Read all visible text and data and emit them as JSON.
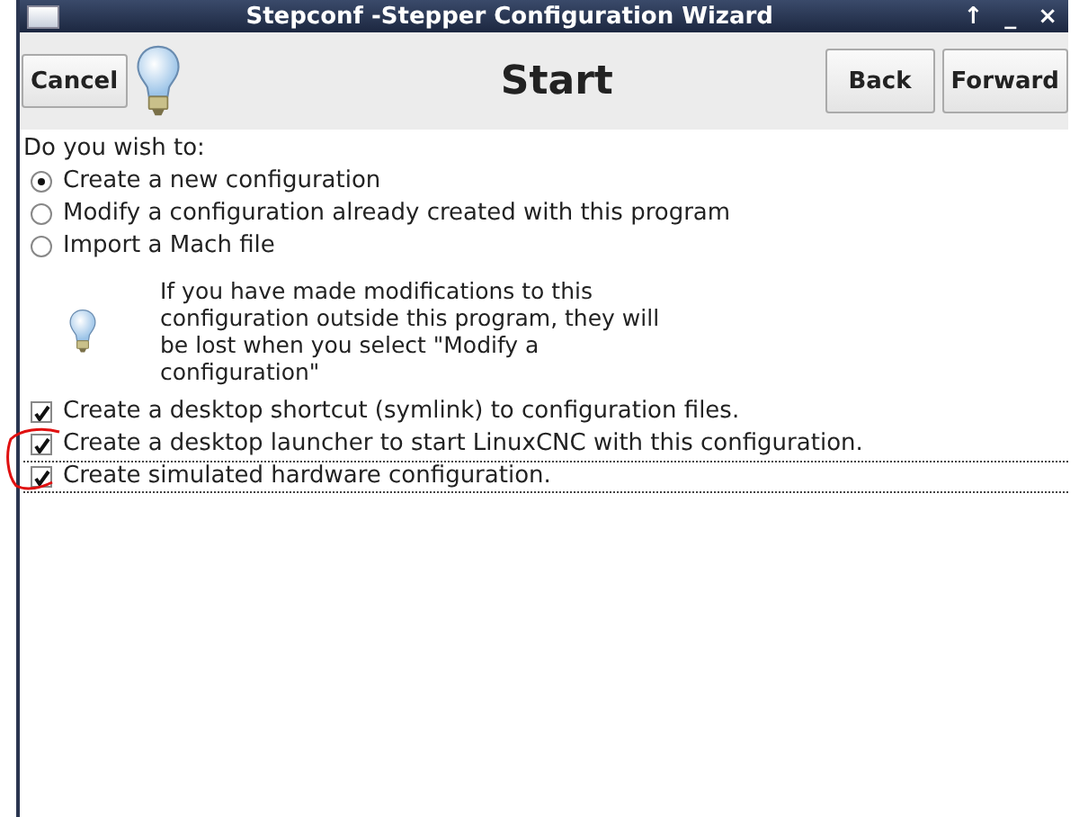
{
  "window": {
    "title": "Stepconf -Stepper Configuration Wizard",
    "controls": [
      "↑",
      "_",
      "×"
    ]
  },
  "toolbar": {
    "cancel": "Cancel",
    "title": "Start",
    "back": "Back",
    "forward": "Forward"
  },
  "prompt": "Do you wish to:",
  "options": [
    {
      "label": "Create a new configuration",
      "selected": true
    },
    {
      "label": "Modify a configuration already created with this program",
      "selected": false
    },
    {
      "label": "Import a Mach file",
      "selected": false
    }
  ],
  "note": "If you have made modifications to this configuration outside this program, they will be lost when you select \"Modify a configuration\"",
  "checks": [
    {
      "label": "Create a desktop shortcut (symlink) to configuration files.",
      "checked": true,
      "focused": false
    },
    {
      "label": "Create a desktop launcher to start LinuxCNC with this configuration.",
      "checked": true,
      "focused": false
    },
    {
      "label": "Create simulated hardware configuration.",
      "checked": true,
      "focused": true
    }
  ],
  "annotation": {
    "kind": "circle"
  }
}
